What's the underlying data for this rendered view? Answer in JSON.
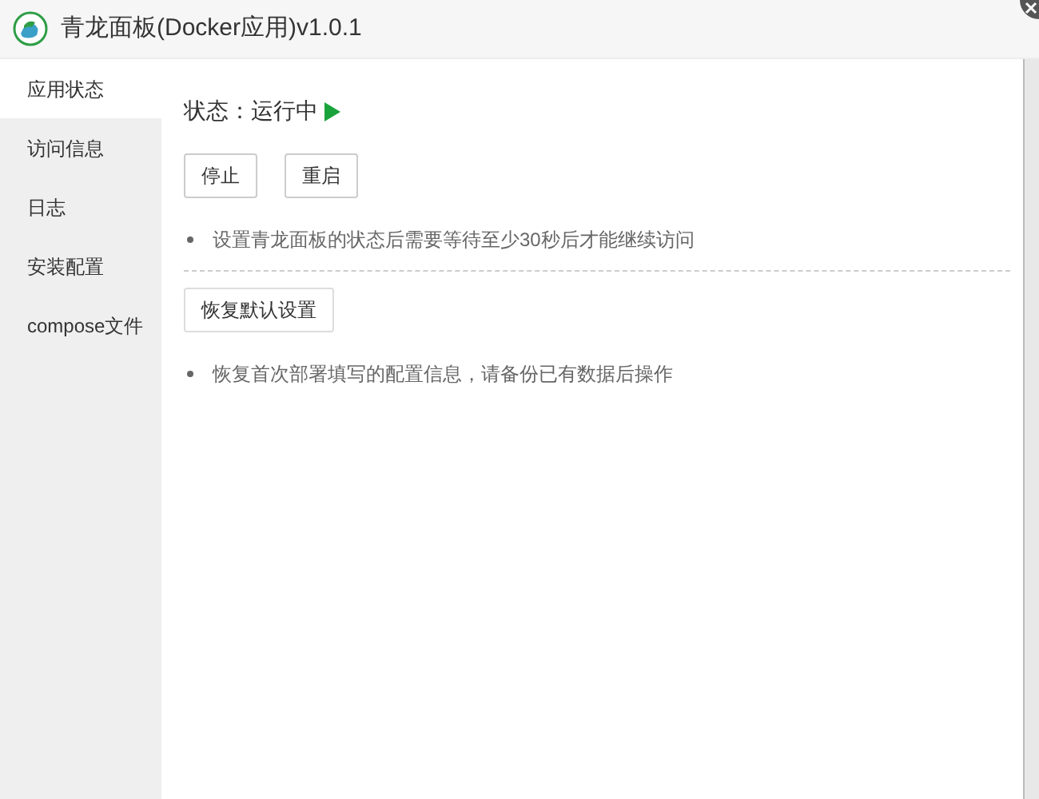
{
  "window": {
    "title": "青龙面板(Docker应用)v1.0.1"
  },
  "sidebar": {
    "items": [
      {
        "label": "应用状态",
        "selected": true
      },
      {
        "label": "访问信息",
        "selected": false
      },
      {
        "label": "日志",
        "selected": false
      },
      {
        "label": "安装配置",
        "selected": false
      },
      {
        "label": "compose文件",
        "selected": false
      }
    ]
  },
  "status": {
    "label": "状态：运行中",
    "running": true
  },
  "buttons": [
    "停止",
    "重启"
  ],
  "note_1": "设置青龙面板的状态后需要等待至少30秒后才能继续访问",
  "reset_button": "恢复默认设置",
  "note_2": "恢复首次部署填写的配置信息，请备份已有数据后操作"
}
